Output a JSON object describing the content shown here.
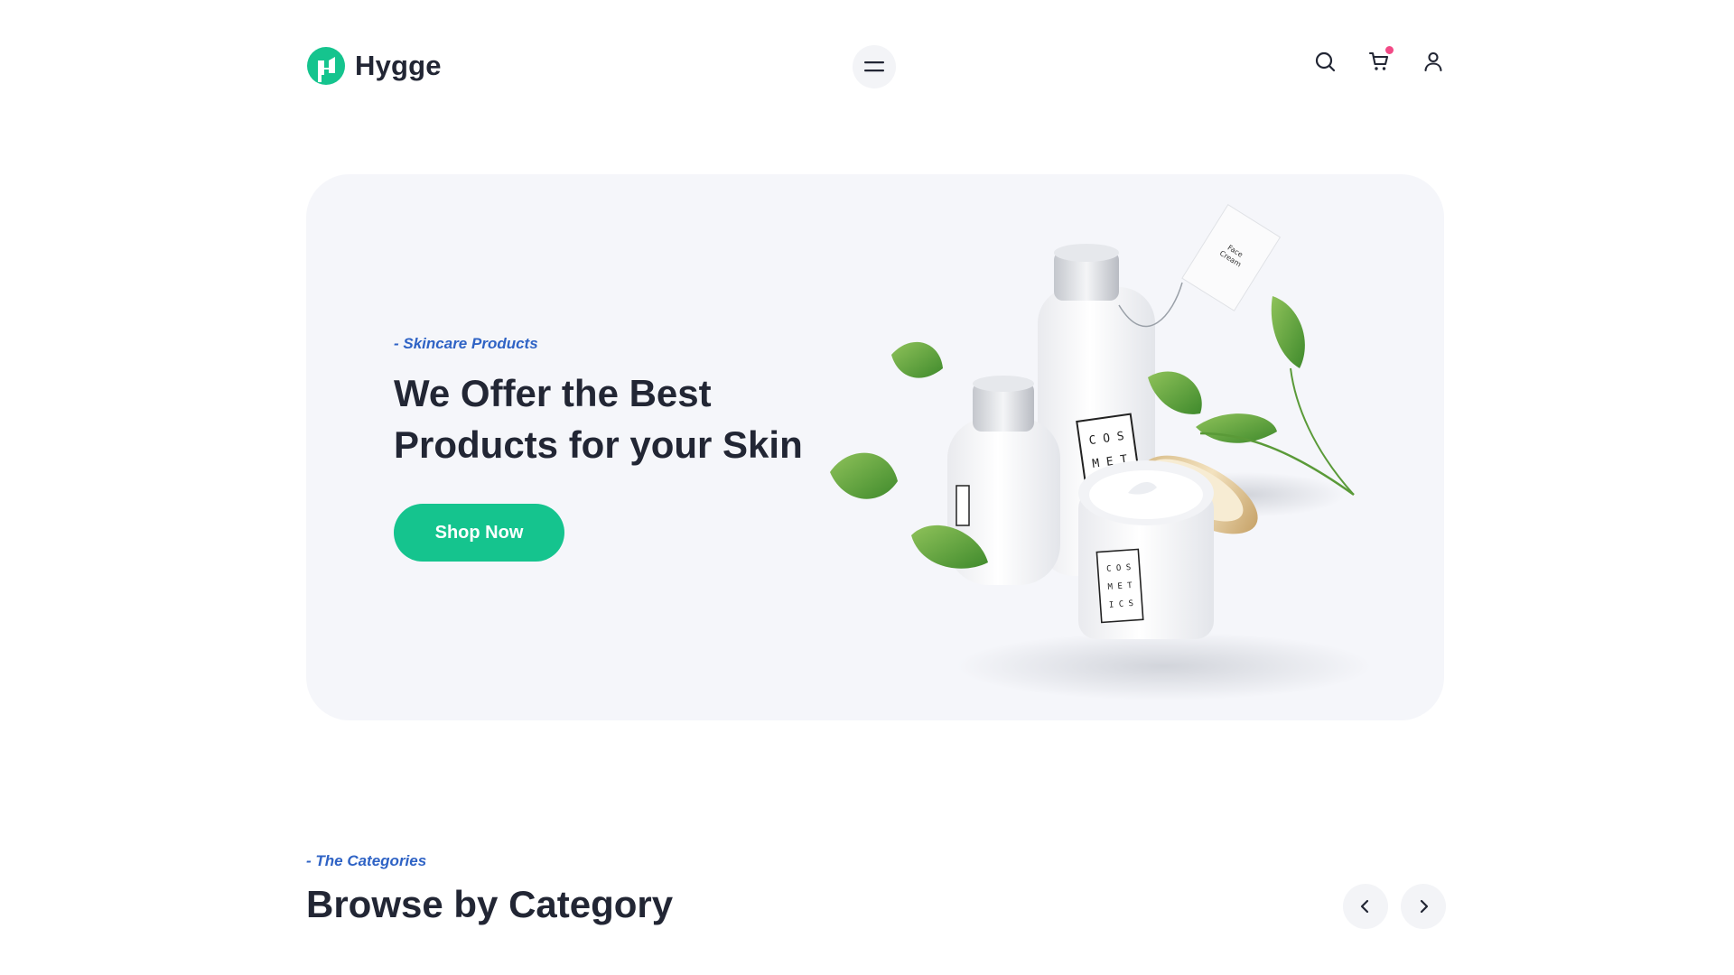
{
  "header": {
    "brand": "Hygge",
    "brand_color": "#15c48e",
    "icons": [
      "menu-icon",
      "search-icon",
      "cart-icon",
      "user-icon"
    ],
    "cart_badge_color": "#f24a86"
  },
  "hero": {
    "kicker": "- Skincare Products",
    "title_line1": "We Offer the Best",
    "title_line2": "Products for your Skin",
    "cta_label": "Shop Now",
    "cta_color": "#15c48e",
    "product_label": "COS MET ICS",
    "tag_label": "Face Cream"
  },
  "categories": {
    "kicker": "- The Categories",
    "title": "Browse by Category",
    "icons": [
      "chevron-left-icon",
      "chevron-right-icon"
    ]
  },
  "colors": {
    "accent_blue": "#2f63c5",
    "heading": "#222634",
    "hero_bg": "#f5f6fa"
  }
}
